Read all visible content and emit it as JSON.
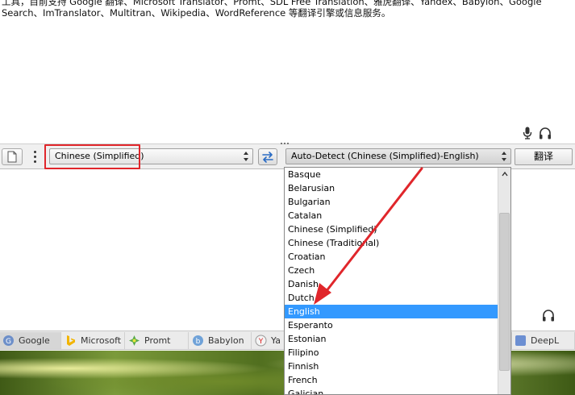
{
  "description": {
    "line1": "工具，目前支持 Google 翻译、Microsoft Translator、Promt、SDL Free Translation、雅虎翻译、Yandex、Babylon、Google",
    "line2": "Search、ImTranslator、Multitran、Wikipedia、WordReference 等翻译引擎或信息服务。"
  },
  "toolbar": {
    "source_language": "Chinese (Simplified)",
    "target_language": "Auto-Detect (Chinese (Simplified)-English)",
    "translate_label": "翻译"
  },
  "dropdown": {
    "items": [
      "Basque",
      "Belarusian",
      "Bulgarian",
      "Catalan",
      "Chinese (Simplified)",
      "Chinese (Traditional)",
      "Croatian",
      "Czech",
      "Danish",
      "Dutch",
      "English",
      "Esperanto",
      "Estonian",
      "Filipino",
      "Finnish",
      "French",
      "Galician"
    ],
    "selected": "English"
  },
  "tabs": [
    {
      "label": "Google",
      "icon": "google-icon",
      "active": true
    },
    {
      "label": "Microsoft",
      "icon": "bing-icon",
      "active": false
    },
    {
      "label": "Promt",
      "icon": "promt-icon",
      "active": false
    },
    {
      "label": "Babylon",
      "icon": "babylon-icon",
      "active": false
    },
    {
      "label": "Ya",
      "icon": "yandex-icon",
      "active": false
    },
    {
      "label": "DeepL",
      "icon": "deepl-icon",
      "active": false
    }
  ],
  "colors": {
    "highlight": "#e0262b",
    "selection": "#3399ff"
  }
}
